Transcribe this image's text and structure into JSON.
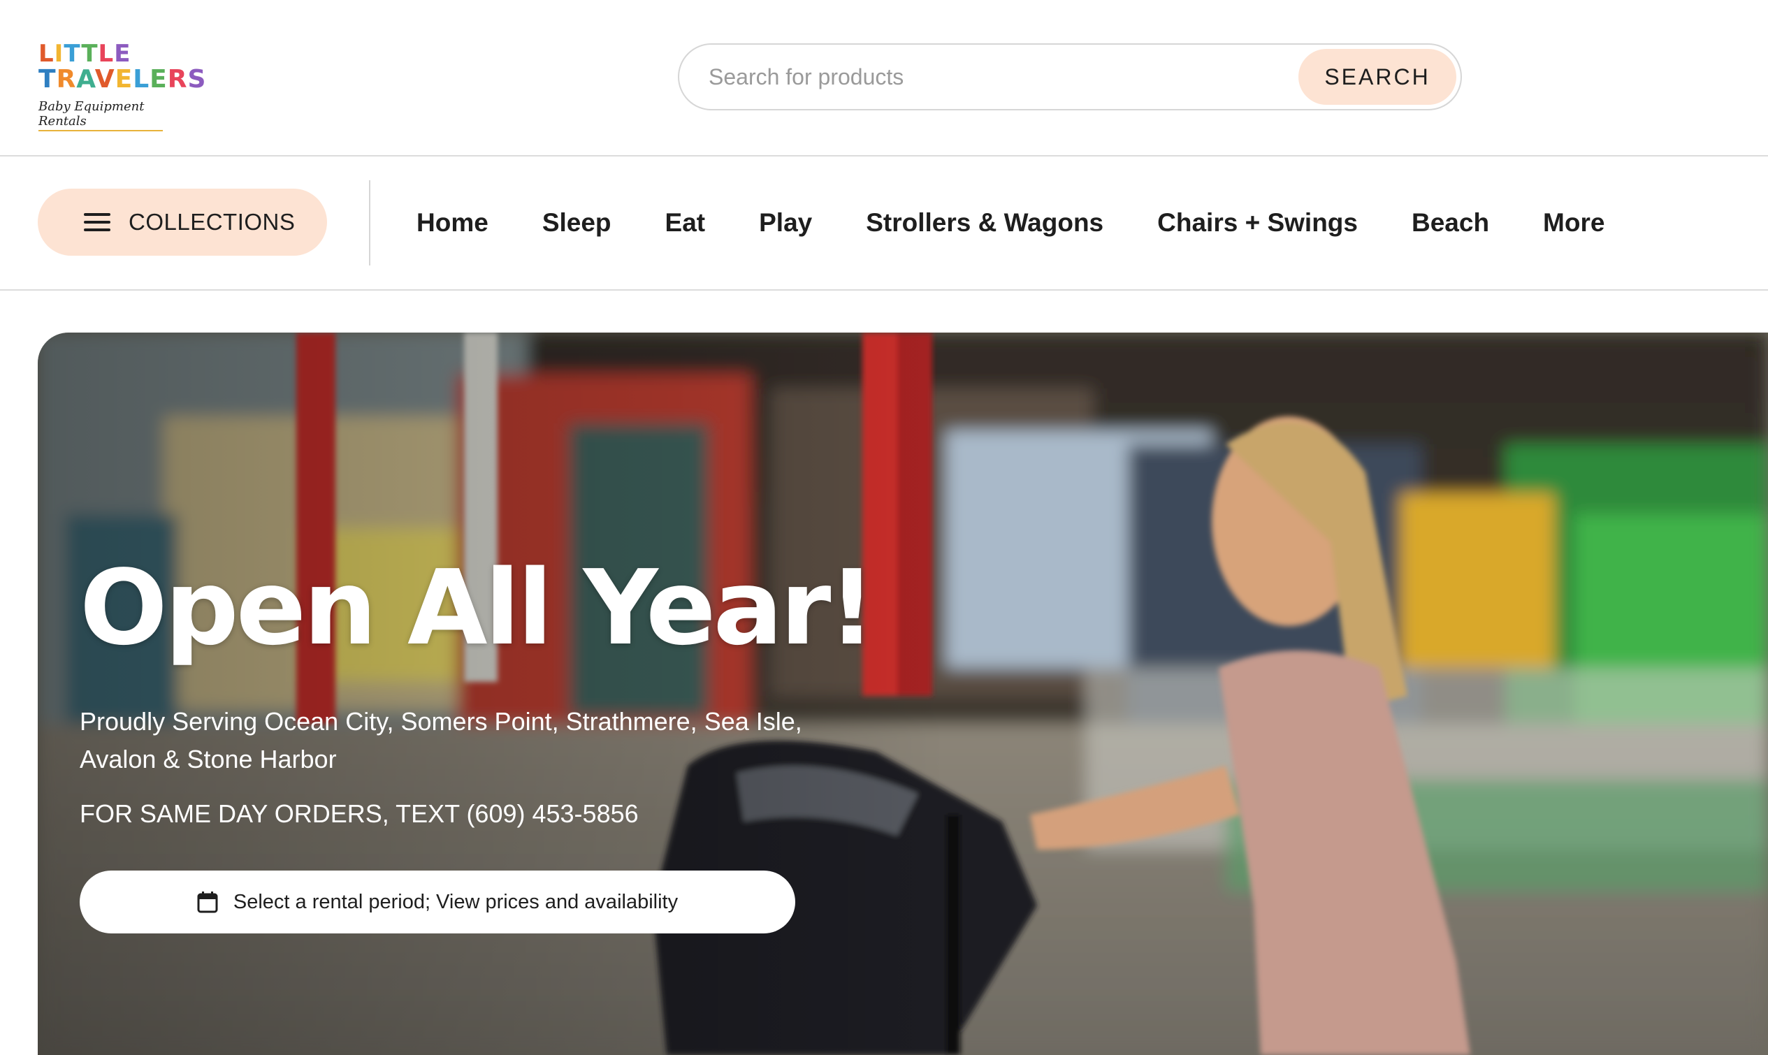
{
  "logo": {
    "line1": "LITTLE",
    "line2": "TRAVELERS",
    "tagline": "Baby Equipment Rentals",
    "letter_colors": [
      "#e05a2b",
      "#f2b531",
      "#3a9fd6",
      "#5ab05a",
      "#e8445a",
      "#8c5bbf",
      "#2f7fc1",
      "#f08a2b",
      "#3fae8f"
    ]
  },
  "search": {
    "placeholder": "Search for products",
    "value": "",
    "button_label": "SEARCH"
  },
  "nav": {
    "collections_label": "COLLECTIONS",
    "links": [
      {
        "label": "Home"
      },
      {
        "label": "Sleep"
      },
      {
        "label": "Eat"
      },
      {
        "label": "Play"
      },
      {
        "label": "Strollers & Wagons"
      },
      {
        "label": "Chairs + Swings"
      },
      {
        "label": "Beach"
      },
      {
        "label": "More"
      }
    ]
  },
  "hero": {
    "title": "Open All Year!",
    "subtitle": "Proudly Serving Ocean City, Somers Point, Strathmere, Sea Isle, Avalon & Stone Harbor",
    "phone_text": "FOR SAME DAY ORDERS, TEXT (609) 453-5856",
    "cta_label": "Select a rental period; View prices and availability",
    "cta_icon": "calendar-icon"
  },
  "colors": {
    "accent_peach": "#fde3d3",
    "text_dark": "#1e1e1e",
    "border_gray": "#d6d6d6"
  }
}
